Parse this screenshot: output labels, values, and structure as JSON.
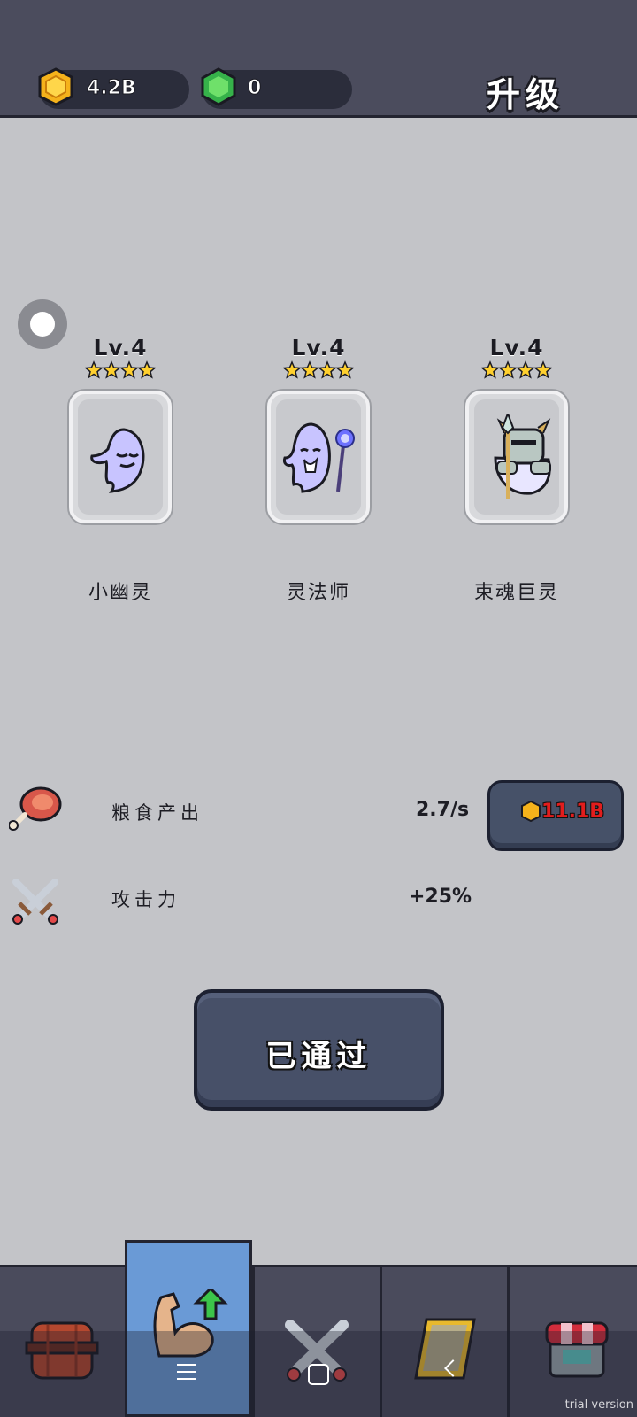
{
  "header": {
    "gold": "4.2B",
    "gems": "0",
    "title": "升级"
  },
  "heroes": [
    {
      "level": "Lv.4",
      "stars": 4,
      "name": "小幽灵",
      "icon": "ghost-icon"
    },
    {
      "level": "Lv.4",
      "stars": 4,
      "name": "灵法师",
      "icon": "ghost-mage-icon"
    },
    {
      "level": "Lv.4",
      "stars": 4,
      "name": "束魂巨灵",
      "icon": "armored-ghost-icon"
    }
  ],
  "stats": {
    "food": {
      "label": "粮食产出",
      "value": "2.7/s",
      "icon": "meat-icon",
      "cost": "11.1B"
    },
    "attack": {
      "label": "攻击力",
      "value": "+25%",
      "icon": "crossed-swords-icon"
    }
  },
  "action_button": "已通过",
  "tabs": [
    {
      "icon": "barrel-icon"
    },
    {
      "icon": "upgrade-muscle-icon",
      "active": true
    },
    {
      "icon": "battle-swords-icon"
    },
    {
      "icon": "book-icon"
    },
    {
      "icon": "shop-icon"
    }
  ],
  "watermark": "trial version",
  "colors": {
    "gold": "#f5b21b",
    "gem": "#36b24a",
    "cost": "#e21d1d",
    "active_tab": "#6a9ad6"
  }
}
